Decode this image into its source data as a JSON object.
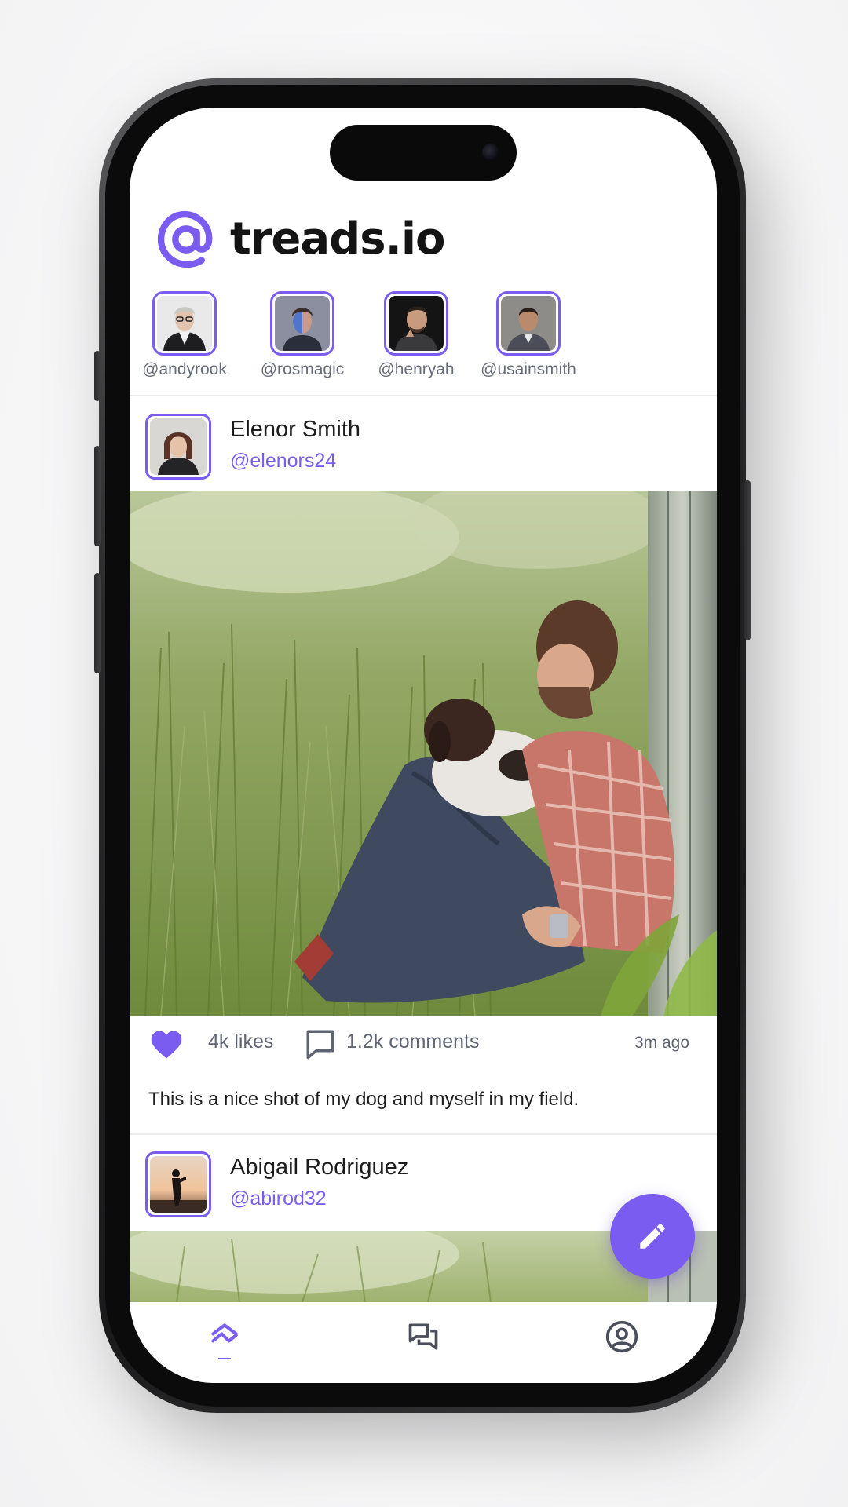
{
  "app": {
    "title": "treads.io",
    "accent": "#7b5cf0"
  },
  "stories": [
    {
      "handle": "@andyrook"
    },
    {
      "handle": "@rosmagic"
    },
    {
      "handle": "@henryah"
    },
    {
      "handle": "@usainsmith"
    }
  ],
  "posts": [
    {
      "name": "Elenor Smith",
      "handle": "@elenors24",
      "likes": "4k likes",
      "comments": "1.2k comments",
      "time": "3m ago",
      "caption": "This is a nice shot of my dog and myself in my field."
    },
    {
      "name": "Abigail Rodriguez",
      "handle": "@abirod32"
    }
  ],
  "icons": {
    "brand": "at-sign-icon",
    "like": "heart-icon",
    "comment": "comment-icon",
    "compose": "pencil-icon",
    "nav_feed": "feed-icon",
    "nav_messages": "messages-icon",
    "nav_profile": "profile-icon"
  }
}
